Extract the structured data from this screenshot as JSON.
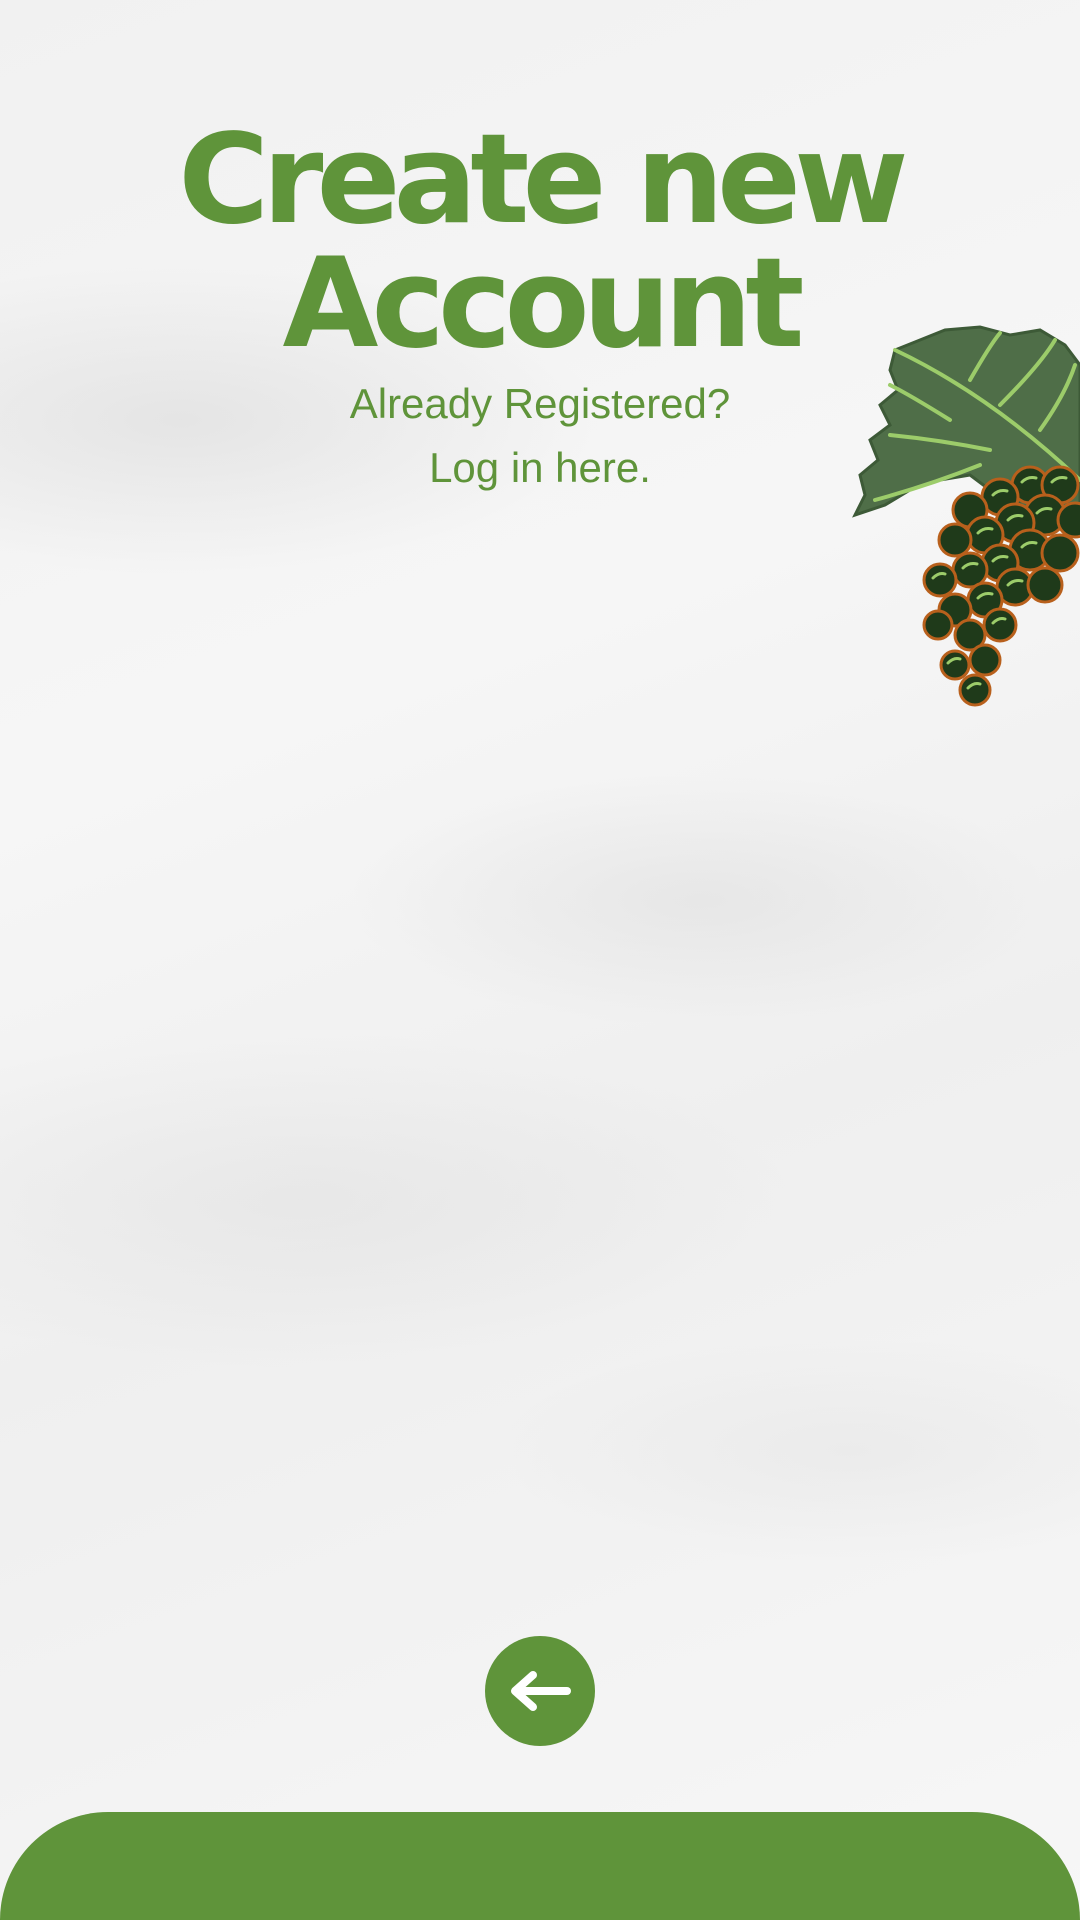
{
  "header": {
    "title_line1": "Create new",
    "title_line2": "Account",
    "subtitle_line1": "Already Registered?",
    "subtitle_line2": "Log in here."
  },
  "icons": {
    "decoration": "grapes-icon",
    "back": "arrow-left-icon"
  },
  "colors": {
    "accent": "#5f943a",
    "leaf": "#4f6e48",
    "grape": "#1f3a1a",
    "grape_outline": "#b8601c"
  }
}
